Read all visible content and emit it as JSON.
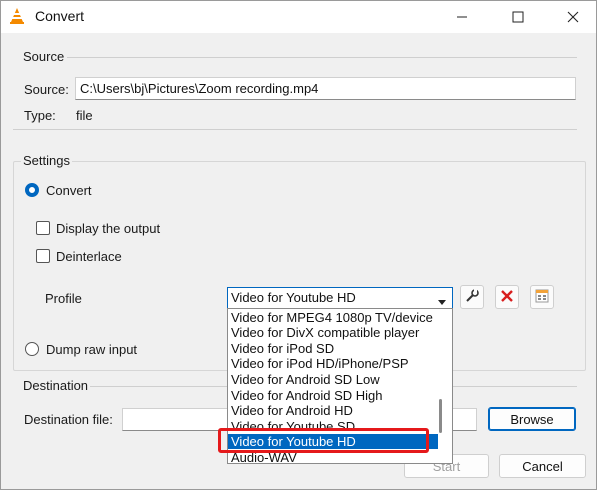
{
  "window": {
    "title": "Convert"
  },
  "source": {
    "group_label": "Source",
    "source_label": "Source:",
    "source_value": "C:\\Users\\bj\\Pictures\\Zoom recording.mp4",
    "type_label": "Type:",
    "type_value": "file"
  },
  "settings": {
    "group_label": "Settings",
    "convert_label": "Convert",
    "display_output_label": "Display the output",
    "deinterlace_label": "Deinterlace",
    "profile_label": "Profile",
    "profile_selected": "Video for Youtube HD",
    "dump_raw_label": "Dump raw input",
    "profile_options": [
      "Video for MPEG4 1080p TV/device",
      "Video for DivX compatible player",
      "Video for iPod SD",
      "Video for iPod HD/iPhone/PSP",
      "Video for Android SD Low",
      "Video for Android SD High",
      "Video for Android HD",
      "Video for Youtube SD",
      "Video for Youtube HD",
      "Audio-WAV"
    ]
  },
  "destination": {
    "group_label": "Destination",
    "file_label": "Destination file:",
    "file_value": "",
    "browse_label": "Browse"
  },
  "footer": {
    "start_label": "Start",
    "cancel_label": "Cancel"
  },
  "icons": {
    "app": "vlc-cone-icon",
    "edit_profile": "wrench-icon",
    "delete_profile": "red-x-icon",
    "new_profile": "new-profile-icon"
  },
  "colors": {
    "accent": "#0067c0",
    "highlight": "#e5191b"
  }
}
